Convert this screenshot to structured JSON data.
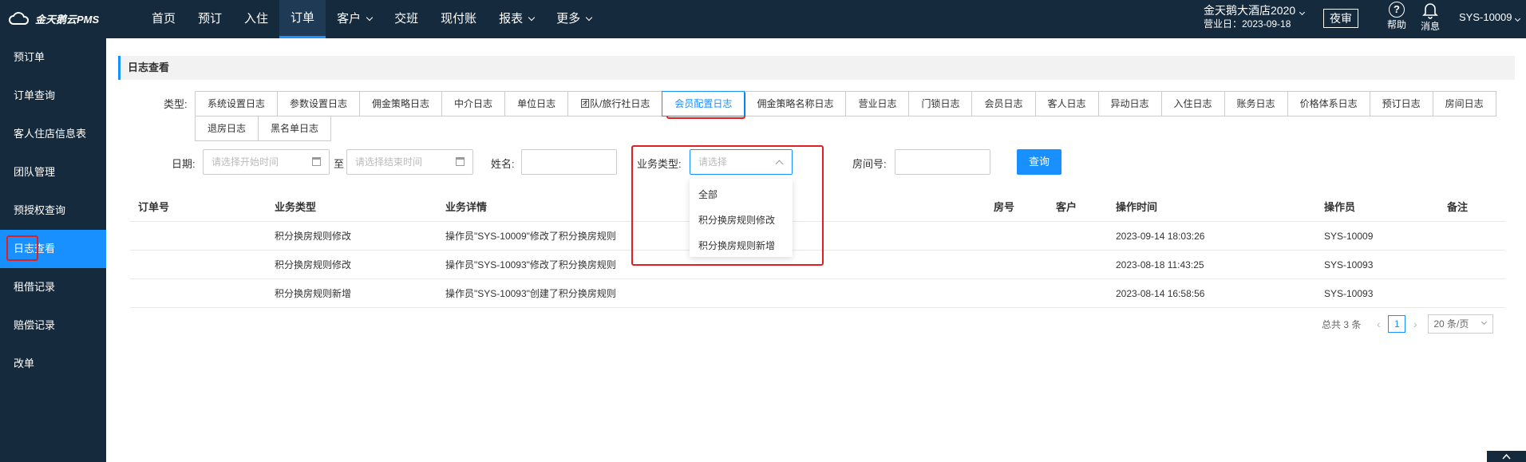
{
  "app": {
    "logo_text": "金天鹅云PMS"
  },
  "nav": {
    "items": [
      {
        "label": "首页"
      },
      {
        "label": "预订"
      },
      {
        "label": "入住"
      },
      {
        "label": "订单"
      },
      {
        "label": "客户"
      },
      {
        "label": "交班"
      },
      {
        "label": "现付账"
      },
      {
        "label": "报表"
      },
      {
        "label": "更多"
      }
    ],
    "active": "订单"
  },
  "hotel": {
    "name": "金天鹅大酒店2020",
    "business_date": "营业日：2023-09-18"
  },
  "night_audit_label": "夜审",
  "help_label": "帮助",
  "message_label": "消息",
  "user": "SYS-10009",
  "sidebar": {
    "items": [
      {
        "label": "预订单"
      },
      {
        "label": "订单查询"
      },
      {
        "label": "客人住店信息表"
      },
      {
        "label": "团队管理"
      },
      {
        "label": "预授权查询"
      },
      {
        "label": "日志查看"
      },
      {
        "label": "租借记录"
      },
      {
        "label": "赔偿记录"
      },
      {
        "label": "改单"
      }
    ],
    "active": "日志查看"
  },
  "page_title": "日志查看",
  "filters": {
    "type_label": "类型:",
    "types_row1": [
      "系统设置日志",
      "参数设置日志",
      "佣金策略日志",
      "中介日志",
      "单位日志",
      "团队/旅行社日志",
      "会员配置日志",
      "佣金策略名称日志",
      "营业日志",
      "门锁日志",
      "会员日志",
      "客人日志",
      "异动日志",
      "入住日志",
      "账务日志",
      "价格体系日志",
      "预订日志",
      "房间日志"
    ],
    "types_row2": [
      "退房日志",
      "黑名单日志"
    ],
    "active_type": "会员配置日志",
    "date_label": "日期:",
    "start_placeholder": "请选择开始时间",
    "to_label": "至",
    "end_placeholder": "请选择结束时间",
    "name_label": "姓名:",
    "biz_type_label": "业务类型:",
    "biz_type_placeholder": "请选择",
    "room_label": "房间号:",
    "query_label": "查询",
    "biz_options": [
      "全部",
      "积分换房规则修改",
      "积分换房规则新增"
    ]
  },
  "table": {
    "headers": {
      "order_no": "订单号",
      "biz_type": "业务类型",
      "biz_detail": "业务详情",
      "room": "房号",
      "customer": "客户",
      "op_time": "操作时间",
      "operator": "操作员",
      "remark": "备注"
    },
    "rows": [
      {
        "order_no": "",
        "biz_type": "积分换房规则修改",
        "biz_detail": "操作员\"SYS-10009\"修改了积分换房规则",
        "room": "",
        "customer": "",
        "op_time": "2023-09-14 18:03:26",
        "operator": "SYS-10009",
        "remark": ""
      },
      {
        "order_no": "",
        "biz_type": "积分换房规则修改",
        "biz_detail": "操作员\"SYS-10093\"修改了积分换房规则",
        "room": "",
        "customer": "",
        "op_time": "2023-08-18 11:43:25",
        "operator": "SYS-10093",
        "remark": ""
      },
      {
        "order_no": "",
        "biz_type": "积分换房规则新增",
        "biz_detail": "操作员\"SYS-10093\"创建了积分换房规则",
        "room": "",
        "customer": "",
        "op_time": "2023-08-14 16:58:56",
        "operator": "SYS-10093",
        "remark": ""
      }
    ]
  },
  "pagination": {
    "total_text": "总共 3 条",
    "current_page": "1",
    "page_size": "20 条/页"
  },
  "colors": {
    "primary": "#1890ff",
    "nav_bg": "#152a3c",
    "highlight": "#e02020"
  }
}
